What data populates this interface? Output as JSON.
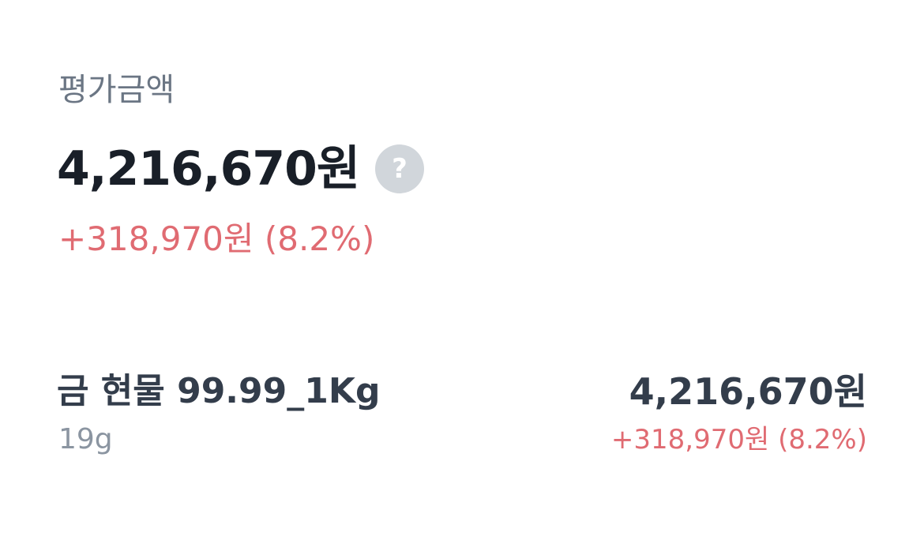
{
  "summary": {
    "label": "평가금액",
    "total_value": "4,216,670원",
    "help_icon": "question-mark-icon",
    "help_glyph": "?",
    "profit": "+318,970원 (8.2%)"
  },
  "holdings": [
    {
      "name": "금 현물 99.99_1Kg",
      "quantity": "19g",
      "value": "4,216,670원",
      "profit": "+318,970원 (8.2%)"
    }
  ],
  "colors": {
    "profit_positive": "#e06b72",
    "text_primary": "#191f28",
    "text_secondary": "#6b7684",
    "help_icon_bg": "#d1d6db"
  }
}
